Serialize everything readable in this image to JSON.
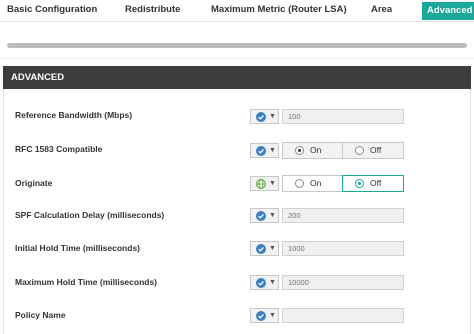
{
  "tabs": [
    {
      "label": "Basic Configuration"
    },
    {
      "label": "Redistribute"
    },
    {
      "label": "Maximum Metric (Router LSA)"
    },
    {
      "label": "Area"
    },
    {
      "label": "Advanced",
      "active": true
    }
  ],
  "section": {
    "title": "ADVANCED"
  },
  "colors": {
    "accent": "#1aa898",
    "header_bg": "#3d3d3d",
    "check_icon": "#3a7fc1",
    "globe_icon": "#6aaa3a"
  },
  "fields": {
    "reference_bandwidth": {
      "label": "Reference Bandwidth (Mbps)",
      "placeholder": "100",
      "source_icon": "check-circle-icon"
    },
    "rfc1583": {
      "label": "RFC 1583 Compatible",
      "options": [
        "On",
        "Off"
      ],
      "selected": "On",
      "source_icon": "check-circle-icon"
    },
    "originate": {
      "label": "Originate",
      "options": [
        "On",
        "Off"
      ],
      "selected": "Off",
      "source_icon": "globe-icon"
    },
    "spf_delay": {
      "label": "SPF Calculation Delay (milliseconds)",
      "placeholder": "200",
      "source_icon": "check-circle-icon"
    },
    "initial_hold": {
      "label": "Initial Hold Time (milliseconds)",
      "placeholder": "1000",
      "source_icon": "check-circle-icon"
    },
    "max_hold": {
      "label": "Maximum Hold Time (milliseconds)",
      "placeholder": "10000",
      "source_icon": "check-circle-icon"
    },
    "policy_name": {
      "label": "Policy Name",
      "placeholder": "",
      "source_icon": "check-circle-icon"
    }
  }
}
